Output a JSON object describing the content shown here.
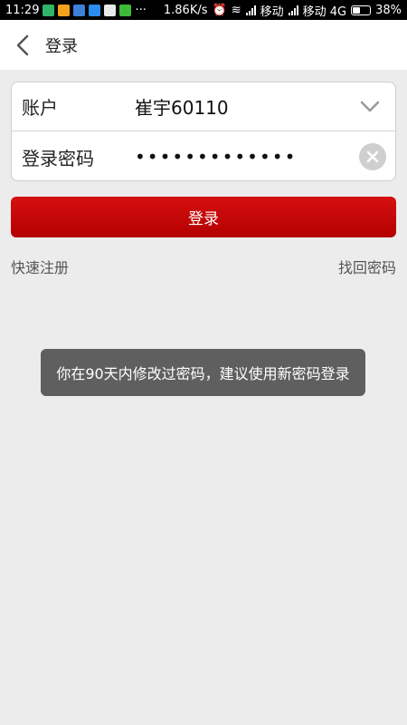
{
  "status_bar": {
    "time": "11:29",
    "speed": "1.86K/s",
    "carrier1": "移动",
    "carrier2": "移动 4G",
    "battery": "38%",
    "icons": [
      "shield-app-icon",
      "calendar-app-icon",
      "photo-app-icon",
      "browser-app-icon",
      "calendar-app-icon",
      "wechat-icon",
      "more-icon",
      "alarm-icon",
      "wifi-icon",
      "signal-icon",
      "signal-icon",
      "battery-icon"
    ]
  },
  "header": {
    "title": "登录"
  },
  "form": {
    "account_label": "账户",
    "account_value": "崔宇60110",
    "password_label": "登录密码",
    "password_value": "•••••••••••••"
  },
  "login_button": "登录",
  "links": {
    "register": "快速注册",
    "recover": "找回密码"
  },
  "toast": "你在90天内修改过密码，建议使用新密码登录",
  "colors": {
    "accent": "#c80000",
    "background": "#ececec",
    "toast": "#5f5f5f"
  }
}
